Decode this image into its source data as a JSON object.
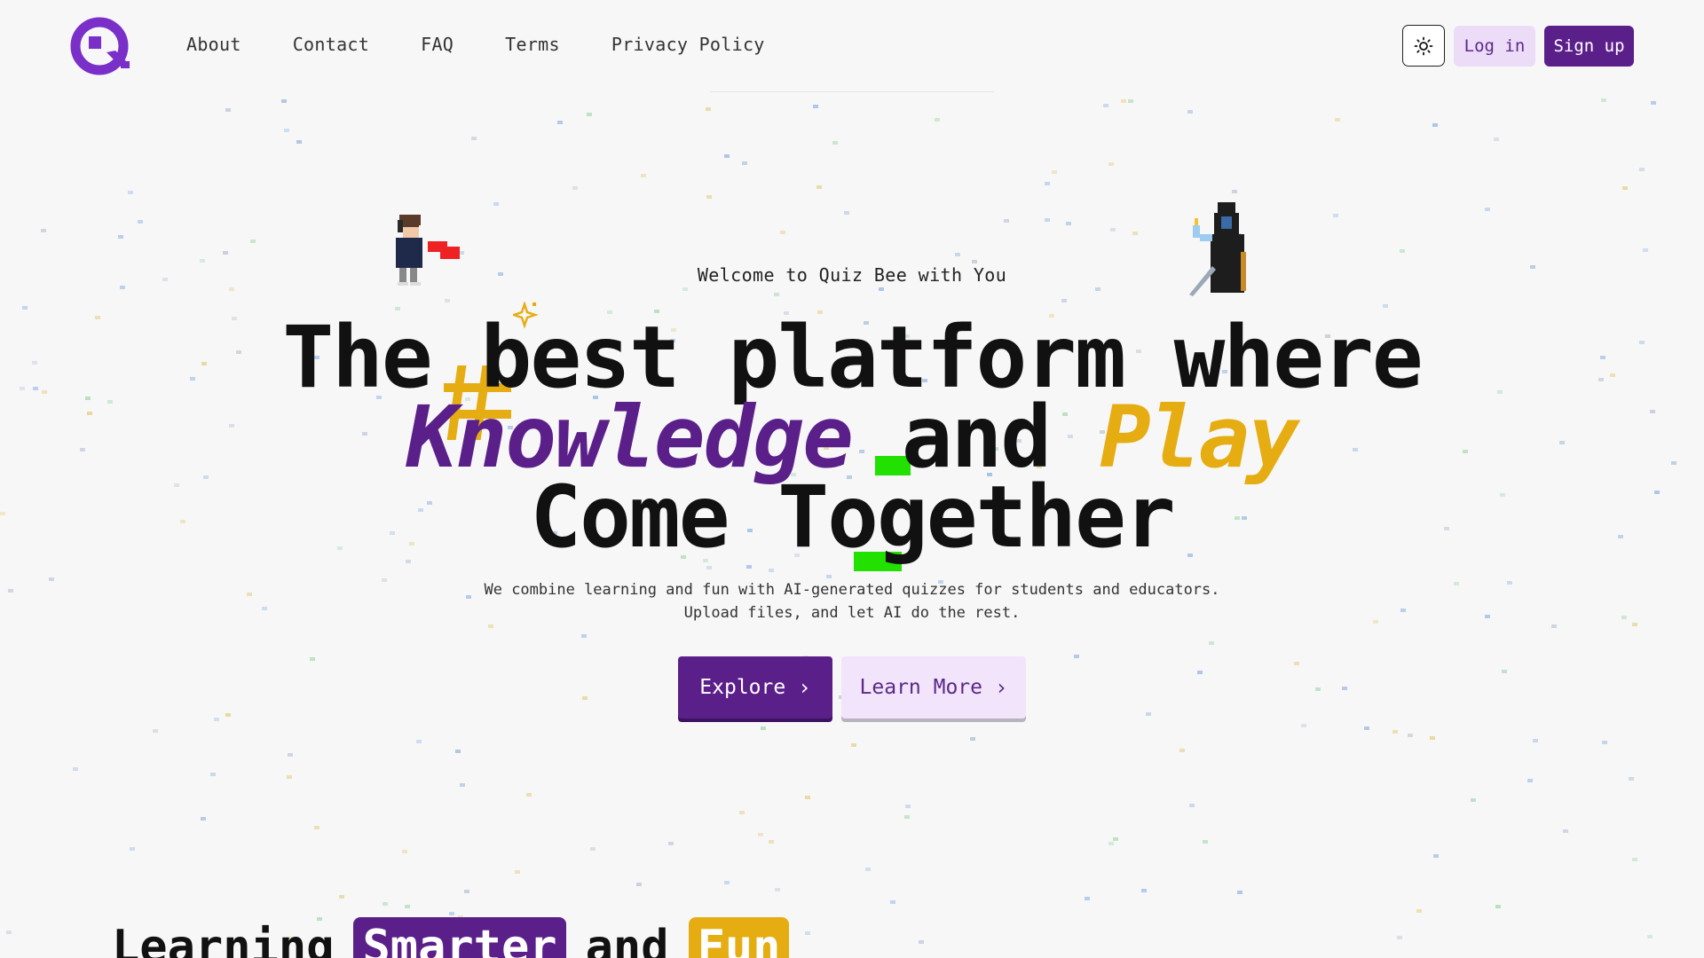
{
  "nav": {
    "items": [
      "About",
      "Contact",
      "FAQ",
      "Terms",
      "Privacy Policy"
    ],
    "login_label": "Log in",
    "signup_label": "Sign up",
    "theme_icon": "sun-icon"
  },
  "hero": {
    "welcome": "Welcome to Quiz Bee with You",
    "line1": "The best platform where",
    "line2_part1": "Knowledge",
    "line2_part2": "and",
    "line2_part3": "Play",
    "line3": "Come Together",
    "description": "We combine learning and fun with AI-generated quizzes for students and educators. Upload files, and let AI do the rest.",
    "explore_label": "Explore",
    "learn_more_label": "Learn More"
  },
  "section2": {
    "word1": "Learning",
    "word2": "Smarter",
    "word3": "and",
    "word4": "Fun"
  },
  "colors": {
    "brand_purple": "#5b1f8a",
    "brand_yellow": "#e6ad12",
    "light_purple": "#ecdcf8",
    "background": "#f7f7f8"
  }
}
